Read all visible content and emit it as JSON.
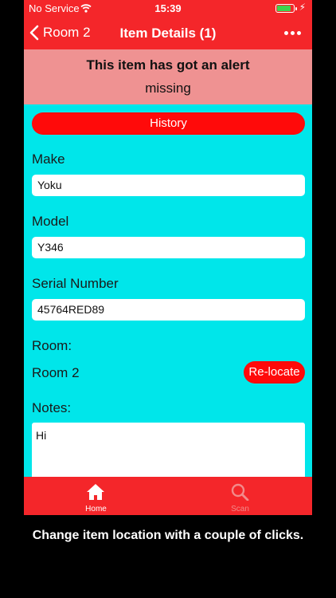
{
  "status_bar": {
    "carrier": "No Service",
    "time": "15:39"
  },
  "nav": {
    "back_label": "Room 2",
    "title": "Item Details (1)"
  },
  "alert": {
    "title": "This item has got an alert",
    "message": "missing"
  },
  "history_button": "History",
  "fields": {
    "make_label": "Make",
    "make_value": "Yoku",
    "model_label": "Model",
    "model_value": "Y346",
    "serial_label": "Serial Number",
    "serial_value": "45764RED89"
  },
  "room": {
    "label": "Room:",
    "value": "Room 2",
    "relocate_label": "Re-locate"
  },
  "notes": {
    "label": "Notes:",
    "value": "Hi"
  },
  "tabs": [
    {
      "label": "Home",
      "icon": "home-icon",
      "active": true
    },
    {
      "label": "Scan",
      "icon": "search-icon",
      "active": false
    }
  ],
  "caption": "Change item location with a couple of clicks.",
  "colors": {
    "bar_red": "#F4262A",
    "button_red": "#FF0A0A",
    "background_cyan": "#00E6EA",
    "alert_pink": "#EF9292",
    "tab_inactive": "#F28A8A"
  }
}
